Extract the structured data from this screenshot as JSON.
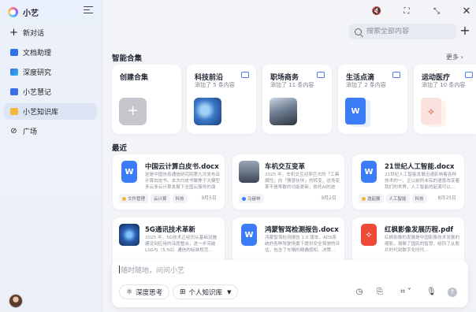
{
  "app": {
    "name": "小艺"
  },
  "sidebar": {
    "items": [
      {
        "label": "新对话",
        "icon": "plus-icon"
      },
      {
        "label": "文档助理",
        "icon": "document-icon"
      },
      {
        "label": "深度研究",
        "icon": "research-icon"
      },
      {
        "label": "小艺慧记",
        "icon": "notes-icon"
      },
      {
        "label": "小艺知识库",
        "icon": "knowledge-base-icon",
        "active": true
      },
      {
        "label": "广场",
        "icon": "plaza-icon"
      }
    ]
  },
  "search": {
    "placeholder": "搜索全部内容"
  },
  "collections": {
    "title": "智能合集",
    "more_label": "更多",
    "items": [
      {
        "title": "创建合集",
        "sub": ""
      },
      {
        "title": "科技前沿",
        "sub": "添加了 5 条内容"
      },
      {
        "title": "职场商务",
        "sub": "添加了 11 条内容"
      },
      {
        "title": "生活点滴",
        "sub": "添加了 2 条内容"
      },
      {
        "title": "运动医疗",
        "sub": "添加了 10 条内容"
      }
    ]
  },
  "recent": {
    "title": "最近",
    "items": [
      {
        "title": "中国云计算白皮书.docx",
        "desc": "这是中国信息通信研究院第九次发布云计算白皮书。本次白皮书聚焦于大模型多云多云计算发展下全国云服务的演进...",
        "tags": [
          "文件管理",
          "云计算",
          "科技"
        ],
        "date": "9月5日"
      },
      {
        "title": "车机交互变革",
        "desc": "2025 年，车机交互迎来巨大的「工具属性」向「情感伙伴」的转变，这场变革不是零散的功能更新，依托AI的进步...",
        "tags": [
          "马赫林"
        ],
        "date": "9月2日"
      },
      {
        "title": "21世纪人工智能.docx",
        "desc": "21世纪人工智能发展迅速影响着各种技术的一，正以前所未有的速度改变着我们的世界，人工智能的起源可以...",
        "tags": [
          "邀起展",
          "人工智能",
          "科技"
        ],
        "date": "8月25日"
      },
      {
        "title": "5G通讯技术革新",
        "desc": "2025 年，5G技术正经历从基础设施建设到应用的深度整合，进一步突破 LSG与（5.5G）通信的标准规范...",
        "tags": [],
        "date": ""
      },
      {
        "title": "鸿蒙智驾检测报告.docx",
        "desc": "鸿蒙智驾检测报告 1.0 版本，ADS系统的各种驾驶场景下提供安全驾驶的评估，包含了车辆的精确感知、决策...",
        "tags": [],
        "date": ""
      },
      {
        "title": "红枫影像发展历程.pdf",
        "desc": "红枫影像的发展是中国影像技术发展的缩影，凝聚了国民的智慧，经历了从胶片时代到数字化时代...",
        "tags": [],
        "date": ""
      }
    ]
  },
  "composer": {
    "placeholder": "随时随地，问问小艺",
    "deep_think_label": "深度思考",
    "kb_label": "个人知识库"
  },
  "colors": {
    "accent": "#3c7cf6",
    "pdf": "#ee4a37",
    "active_nav": "#dde5f5"
  }
}
